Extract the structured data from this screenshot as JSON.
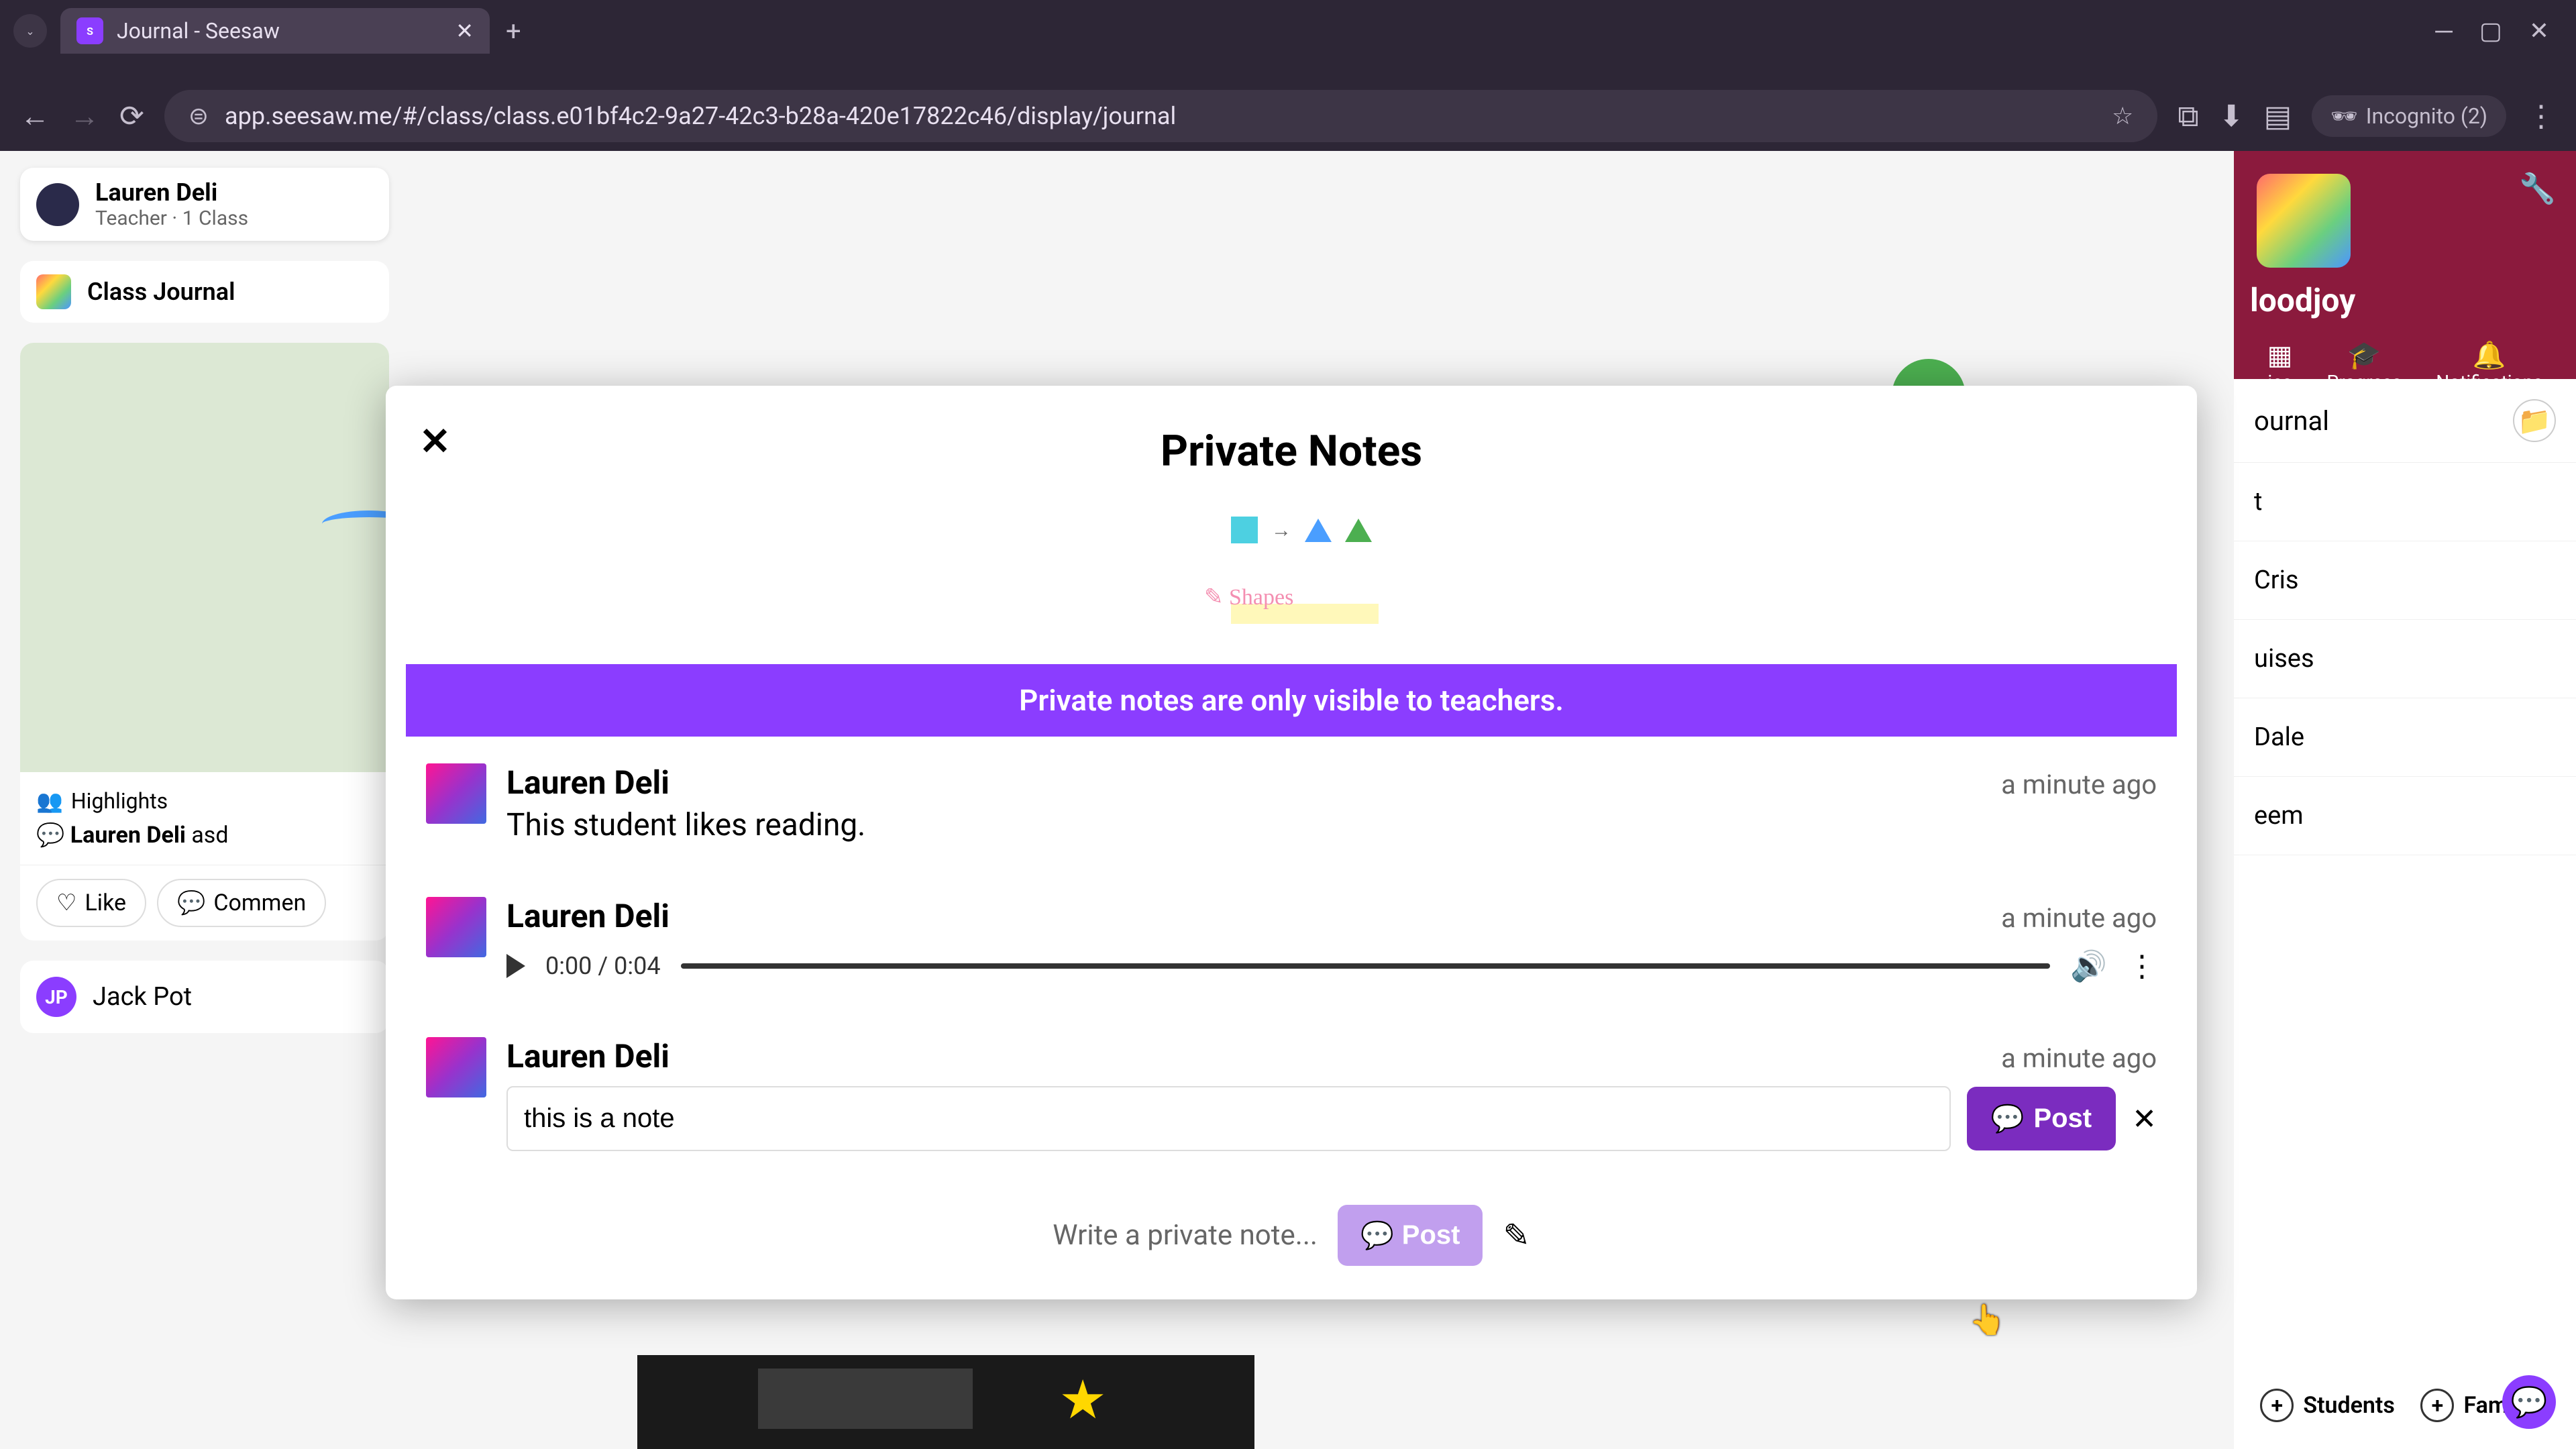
{
  "browser": {
    "tab_title": "Journal - Seesaw",
    "url": "app.seesaw.me/#/class/class.e01bf4c2-9a27-42c3-b28a-420e17822c46/display/journal",
    "incognito": "Incognito (2)"
  },
  "teacher": {
    "name": "Lauren Deli",
    "role": "Teacher · 1 Class"
  },
  "sidebar": {
    "journal_label": "Class Journal",
    "highlights": "Highlights",
    "post_author": "Lauren Deli",
    "post_suffix": "asd",
    "like": "Like",
    "comment": "Commen",
    "bottom_author": "Jack Pot",
    "bottom_initials": "JP"
  },
  "right": {
    "class_name": "loodjoy",
    "tabs": {
      "activities": "ies",
      "progress": "Progress",
      "notifications": "Notifications"
    },
    "journal": "ournal",
    "students": [
      "t",
      "Cris",
      "uises",
      "Dale",
      "eem"
    ],
    "add_students": "Students",
    "add_families": "Families"
  },
  "modal": {
    "title": "Private Notes",
    "banner": "Private notes are only visible to teachers.",
    "notes": [
      {
        "author": "Lauren Deli",
        "time": "a minute ago",
        "text": "This student likes reading."
      },
      {
        "author": "Lauren Deli",
        "time": "a minute ago",
        "audio_time": "0:00 / 0:04"
      },
      {
        "author": "Lauren Deli",
        "time": "a minute ago",
        "edit_value": "this is a note"
      }
    ],
    "post_button": "Post",
    "footer_placeholder": "Write a private note...",
    "footer_post": "Post"
  }
}
